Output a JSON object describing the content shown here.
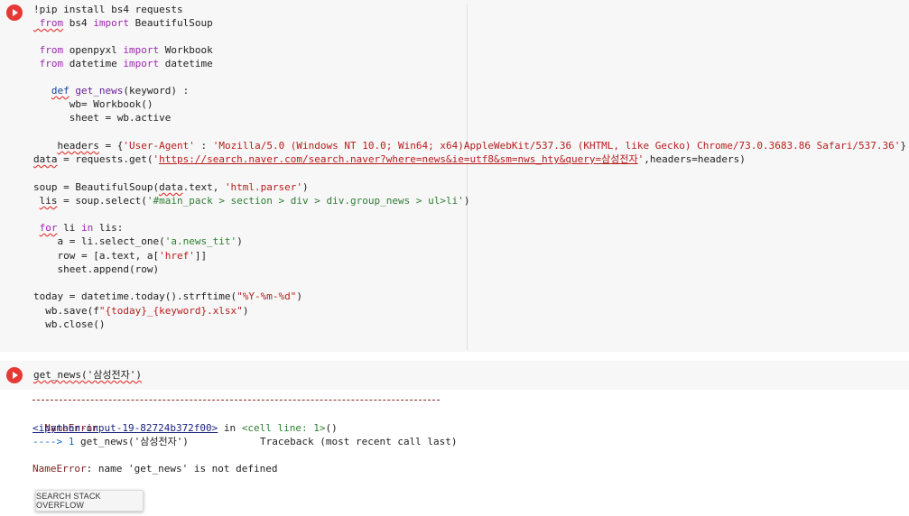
{
  "cell1": {
    "run_icon": "play-icon",
    "lines": [
      "!pip install bs4 requests",
      " from bs4 import BeautifulSoup",
      "",
      " from openpyxl import Workbook",
      " from datetime import datetime",
      "",
      "   def get_news(keyword) :",
      "      wb= Workbook()",
      "      sheet = wb.active",
      "",
      "    headers = {'User-Agent' : 'Mozilla/5.0 (Windows NT 10.0; Win64; x64)AppleWebKit/537.36 (KHTML, like Gecko) Chrome/73.0.3683.86 Safari/537.36'}",
      "data = requests.get('https://search.naver.com/search.naver?where=news&ie=utf8&sm=nws_hty&query=삼성전자',headers=headers)",
      "",
      "soup = BeautifulSoup(data.text, 'html.parser')",
      " lis = soup.select('#main_pack > section > div > div.group_news > ul>li')",
      "",
      " for li in lis:",
      "    a = li.select_one('a.news_tit')",
      "    row = [a.text, a['href']]",
      "    sheet.append(row)",
      "",
      "today = datetime.today().strftime(\"%Y-%m-%d\")",
      "  wb.save(f\"{today}_{keyword}.xlsx\")",
      "  wb.close()"
    ]
  },
  "cell2": {
    "run_icon": "play-icon",
    "code": "get_news('삼성전자')"
  },
  "output": {
    "separator": "---------------------------------------------------------------------------",
    "error_type": "NameError",
    "traceback_label": "Traceback (most recent call last)",
    "input_ref": "<ipython-input-19-82724b372f00>",
    "in_text": " in ",
    "cell_ref": "<cell line: 1>",
    "cell_ref_suffix": "()",
    "arrow": "----> 1 ",
    "arrow_code": "get_news('삼성전자')",
    "error_prefix": "NameError",
    "error_message": ": name 'get_news' is not defined",
    "search_button": "SEARCH STACK OVERFLOW"
  },
  "colors": {
    "run_button": "#e53935",
    "keyword": "#9c27b0",
    "string": "#b71c1c",
    "link": "#1a237e"
  }
}
